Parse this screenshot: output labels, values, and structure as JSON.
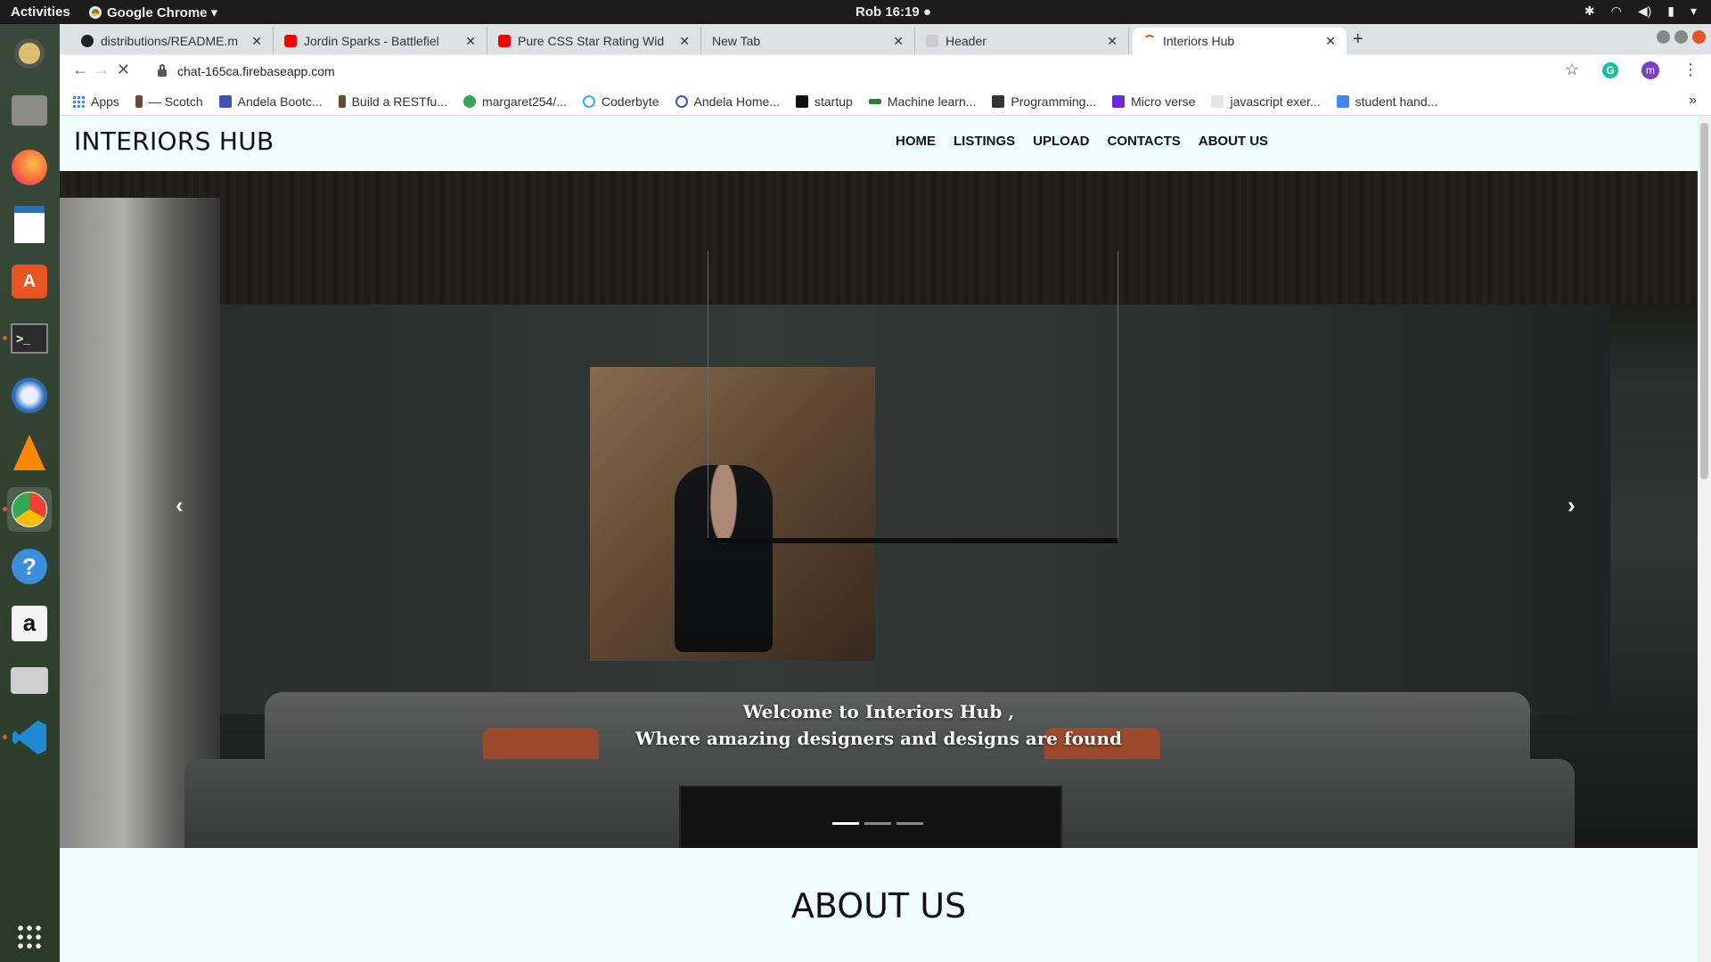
{
  "system_bar": {
    "activities": "Activities",
    "app_name": "Google Chrome ▾",
    "clock": "Rob 16:19 ●",
    "tray_icons": [
      "bluetooth-icon",
      "wifi-icon",
      "volume-icon",
      "battery-icon",
      "power-menu-icon"
    ]
  },
  "dock": {
    "items": [
      "rhythmbox",
      "files",
      "firefox",
      "writer",
      "software-center",
      "terminal",
      "thunderbird",
      "vlc",
      "chrome",
      "help",
      "amazon",
      "printer",
      "vscode",
      "app-grid"
    ]
  },
  "browser": {
    "tabs": [
      {
        "title": "distributions/README.m",
        "favicon": "github-icon"
      },
      {
        "title": "Jordin Sparks - Battlefiel",
        "favicon": "youtube-icon"
      },
      {
        "title": "Pure CSS Star Rating Wid",
        "favicon": "youtube-icon"
      },
      {
        "title": "New Tab",
        "favicon": ""
      },
      {
        "title": "Header",
        "favicon": "page-icon"
      },
      {
        "title": "Interiors Hub",
        "favicon": "loading-icon",
        "active": true
      }
    ],
    "url": "chat-165ca.firebaseapp.com",
    "bookmarks": [
      {
        "label": "Apps",
        "color": "#4285f4"
      },
      {
        "label": "— Scotch",
        "color": "#6b4a2a"
      },
      {
        "label": "Andela Bootc...",
        "color": "#3f51b5"
      },
      {
        "label": "Build a RESTfu...",
        "color": "#6b4a2a"
      },
      {
        "label": "margaret254/...",
        "color": "#34a853"
      },
      {
        "label": "Coderbyte",
        "color": "#29b6f6"
      },
      {
        "label": "Andela Home...",
        "color": "#3f51b5"
      },
      {
        "label": "startup",
        "color": "#111111"
      },
      {
        "label": "Machine learn...",
        "color": "#2e7d32"
      },
      {
        "label": "Programming...",
        "color": "#333333"
      },
      {
        "label": "Micro verse",
        "color": "#6c2bd9"
      },
      {
        "label": "javascript exer...",
        "color": "#aaaaaa"
      },
      {
        "label": "student hand...",
        "color": "#4285f4"
      }
    ],
    "more": "»"
  },
  "site": {
    "logo": "INTERIORS HUB",
    "nav": [
      "HOME",
      "LISTINGS",
      "UPLOAD",
      "CONTACTS",
      "ABOUT US"
    ],
    "hero": {
      "caption_line1": "Welcome to Interiors Hub ,",
      "caption_line2": "Where amazing designers and designs are found",
      "prev": "‹",
      "next": "›",
      "slides": 3,
      "active_slide": 1
    },
    "about_title": "ABOUT US"
  }
}
